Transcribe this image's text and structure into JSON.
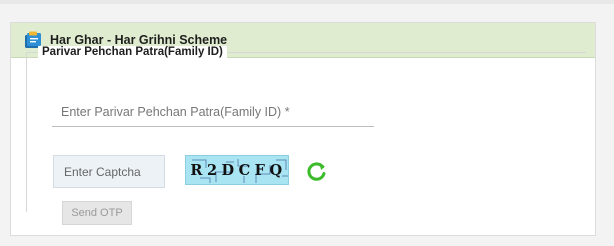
{
  "header": {
    "title": "Har Ghar - Har Grihni Scheme",
    "icon": "document-stack-icon",
    "bg_color": "#dfeccf"
  },
  "form": {
    "section_label": "Parivar Pehchan Patra(Family ID)",
    "family_id": {
      "placeholder": "Enter Parivar Pehchan Patra(Family ID) *",
      "value": ""
    },
    "captcha_input": {
      "placeholder": "Enter Captcha",
      "value": ""
    },
    "captcha_text": "R2DCFQ",
    "refresh_icon": "refresh-icon",
    "refresh_color": "#3dbb2c",
    "send_otp_label": "Send OTP",
    "send_otp_disabled": true
  }
}
